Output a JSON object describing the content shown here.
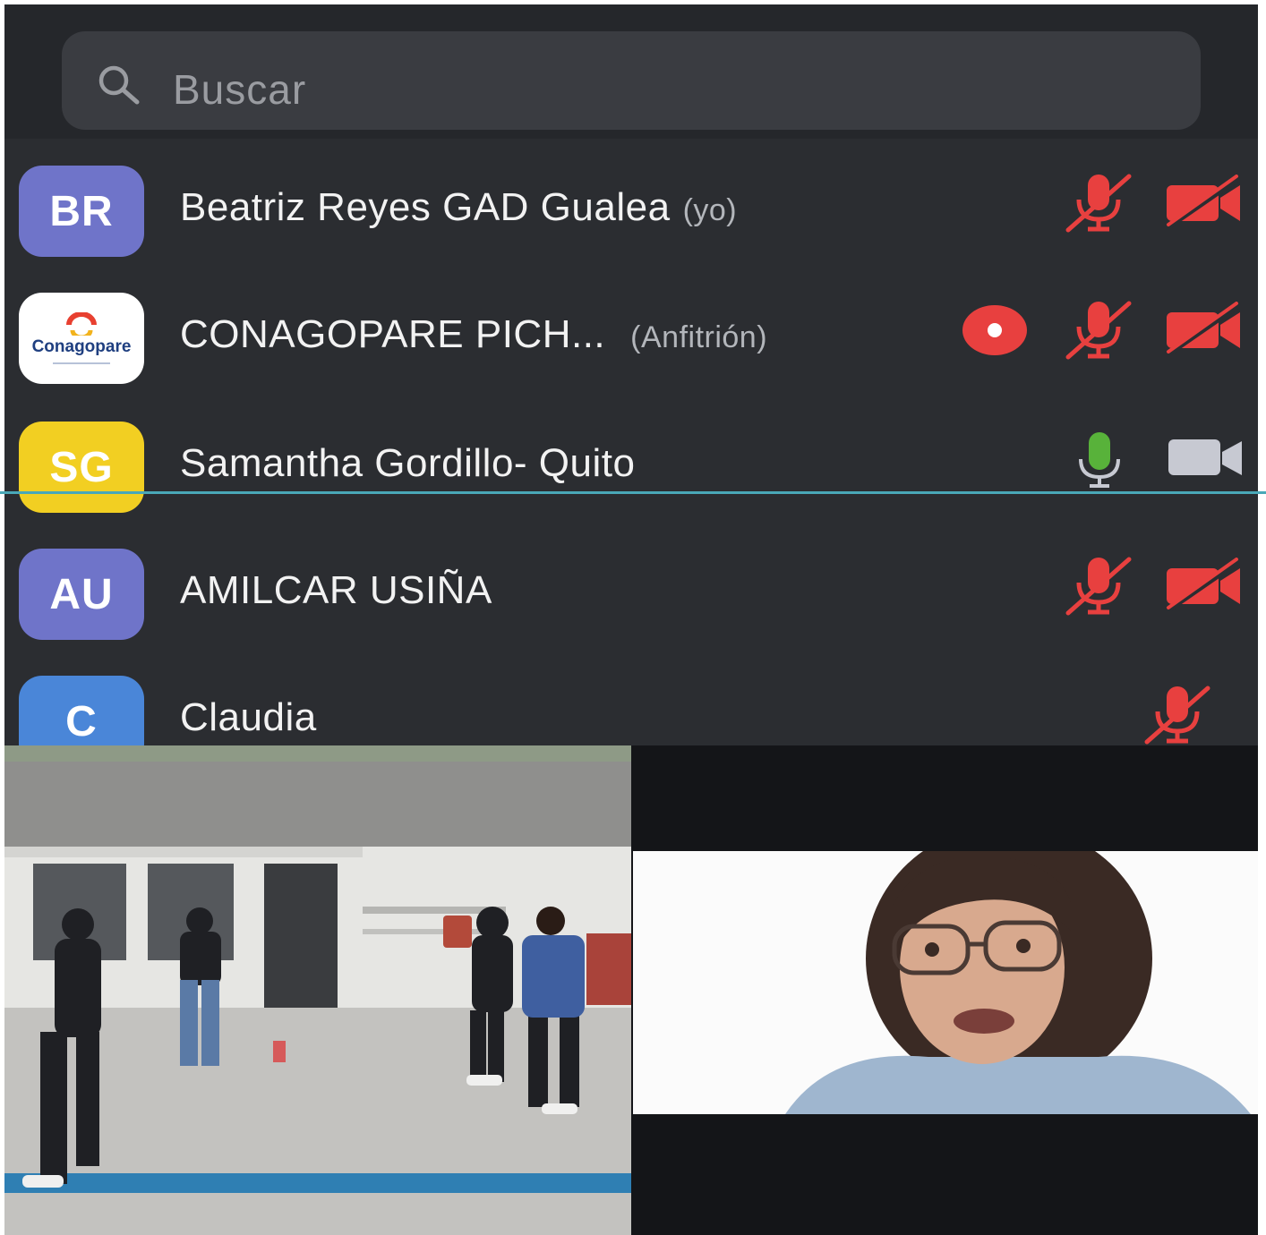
{
  "search": {
    "placeholder": "Buscar",
    "icon": "search-icon"
  },
  "participants": [
    {
      "initials": "BR",
      "avatar_color": "#6f74c9",
      "name": "Beatriz Reyes GAD Gualea",
      "tag": "(yo)",
      "mic": "muted",
      "camera": "off"
    },
    {
      "logo_text": "Conagopare",
      "name": "CONAGOPARE PICH...",
      "tag": "(Anfitrión)",
      "recording": true,
      "mic": "muted",
      "camera": "off"
    },
    {
      "initials": "SG",
      "avatar_color": "#f2cf22",
      "name": "Samantha Gordillo- Quito",
      "tag": "",
      "mic": "active",
      "camera": "on"
    },
    {
      "initials": "AU",
      "avatar_color": "#6f74c9",
      "name": "AMILCAR USIÑA",
      "tag": "",
      "mic": "muted",
      "camera": "off"
    },
    {
      "initials": "C",
      "avatar_color": "#4a86d8",
      "name": "Claudia",
      "tag": "",
      "mic": "muted"
    }
  ],
  "colors": {
    "muted": "#e8403f",
    "active_mic": "#58b23a",
    "camera_on": "#c7c9d2",
    "panel_bg": "#2b2d31"
  }
}
